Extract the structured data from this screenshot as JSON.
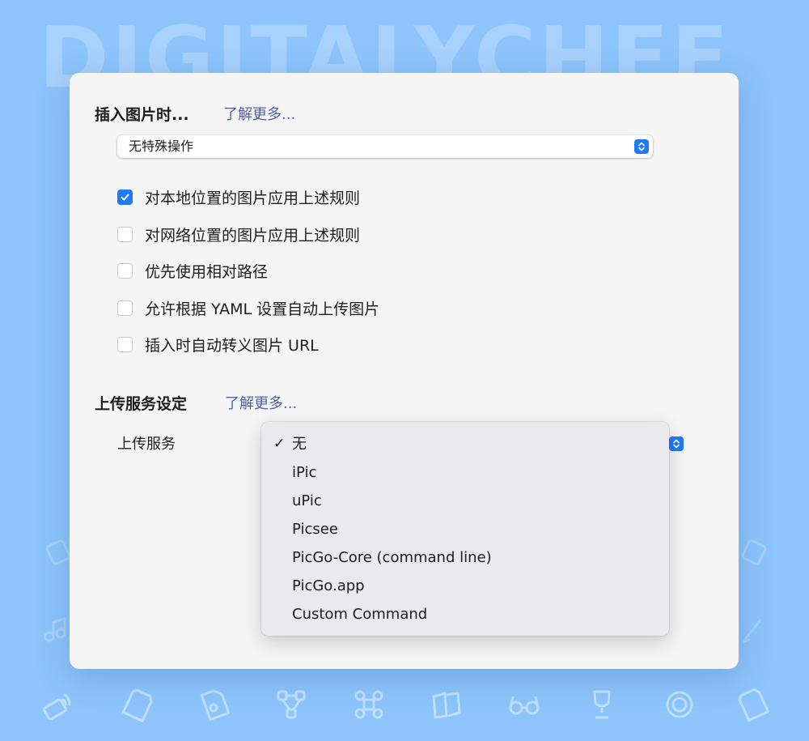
{
  "watermark": "DIGITALYCHEE",
  "insert_section": {
    "title": "插入图片时...",
    "learn_more": "了解更多...",
    "select_value": "无特殊操作",
    "options": [
      {
        "label": "对本地位置的图片应用上述规则",
        "checked": true
      },
      {
        "label": "对网络位置的图片应用上述规则",
        "checked": false
      },
      {
        "label": "优先使用相对路径",
        "checked": false
      },
      {
        "label": "允许根据 YAML 设置自动上传图片",
        "checked": false
      },
      {
        "label": "插入时自动转义图片 URL",
        "checked": false
      }
    ]
  },
  "upload_section": {
    "title": "上传服务设定",
    "learn_more": "了解更多...",
    "service_label": "上传服务",
    "menu": {
      "selected": "无",
      "items": [
        "无",
        "iPic",
        "uPic",
        "Picsee",
        "PicGo-Core (command line)",
        "PicGo.app",
        "Custom Command"
      ]
    }
  },
  "colors": {
    "background": "#8cc4fb",
    "accent": "#1f7af5",
    "link": "#4f62a8"
  },
  "icons": [
    "wifi-card-icon",
    "sd-card-icon",
    "document-icon",
    "nodes-icon",
    "command-key-icon",
    "book-icon",
    "glasses-icon",
    "trophy-icon",
    "question-badge-icon",
    "sd-card-icon"
  ]
}
